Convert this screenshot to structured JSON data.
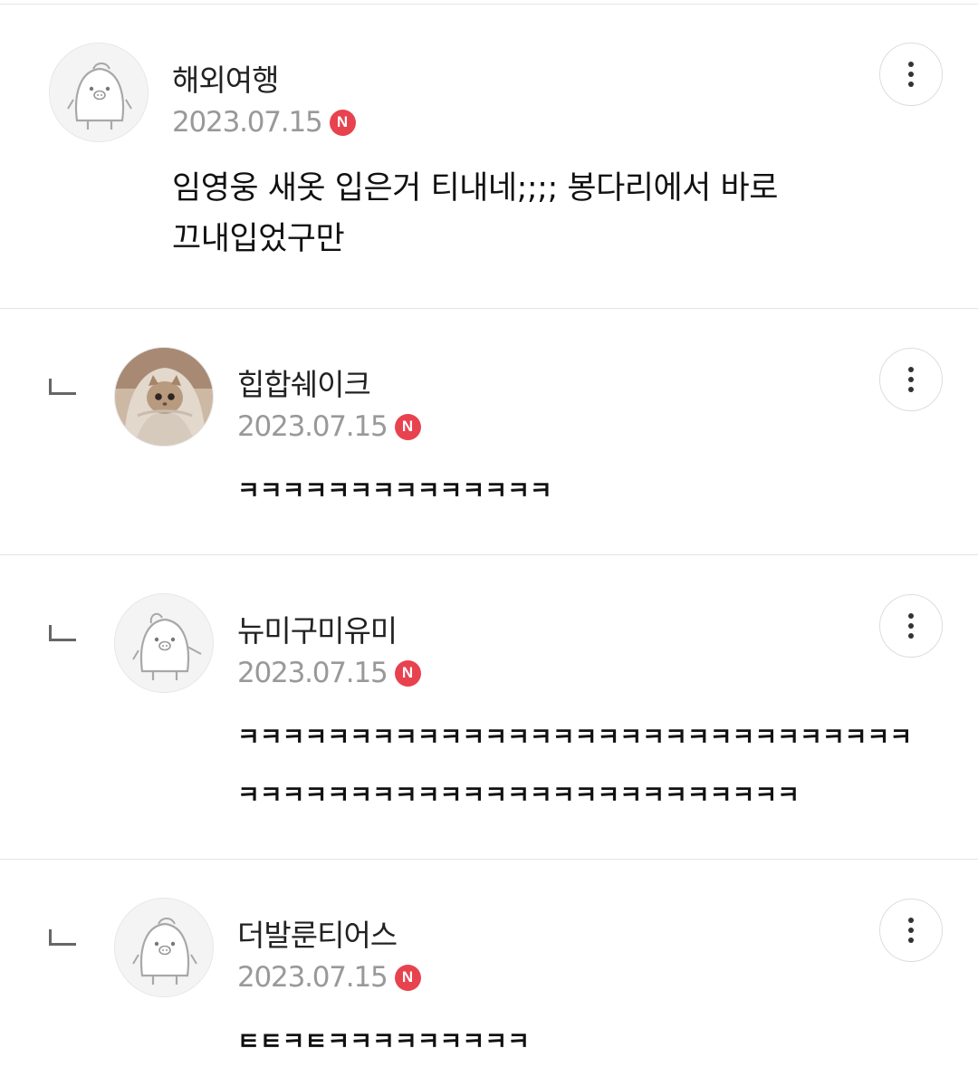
{
  "comments": [
    {
      "nickname": "해외여행",
      "date": "2023.07.15",
      "badge": "N",
      "text_lines": [
        "임영웅 새옷 입은거 티내네;;;; 봉다리에서 바로",
        "끄내입었구만"
      ],
      "avatar": "penguin-icon",
      "is_reply": false
    },
    {
      "nickname": "힙합쉐이크",
      "date": "2023.07.15",
      "badge": "N",
      "text_lines": [
        "ㅋㅋㅋㅋㅋㅋㅋㅋㅋㅋㅋㅋㅋㅋ"
      ],
      "avatar": "cat-photo",
      "is_reply": true
    },
    {
      "nickname": "뉴미구미유미",
      "date": "2023.07.15",
      "badge": "N",
      "text_lines": [
        "ㅋㅋㅋㅋㅋㅋㅋㅋㅋㅋㅋㅋㅋㅋㅋㅋㅋㅋㅋㅋㅋㅋㅋㅋㅋㅋㅋㅋㅋㅋ",
        "ㅋㅋㅋㅋㅋㅋㅋㅋㅋㅋㅋㅋㅋㅋㅋㅋㅋㅋㅋㅋㅋㅋㅋㅋㅋ"
      ],
      "avatar": "penguin-icon",
      "is_reply": true
    },
    {
      "nickname": "더발룬티어스",
      "date": "2023.07.15",
      "badge": "N",
      "text_lines": [
        "ㅌㅌㅋㅌㅋㅋㅋㅋㅋㅋㅋㅋㅋ"
      ],
      "avatar": "penguin-icon",
      "is_reply": true
    }
  ],
  "colors": {
    "badge": "#e8424f",
    "date": "#999999",
    "divider": "#e3e3e3"
  }
}
